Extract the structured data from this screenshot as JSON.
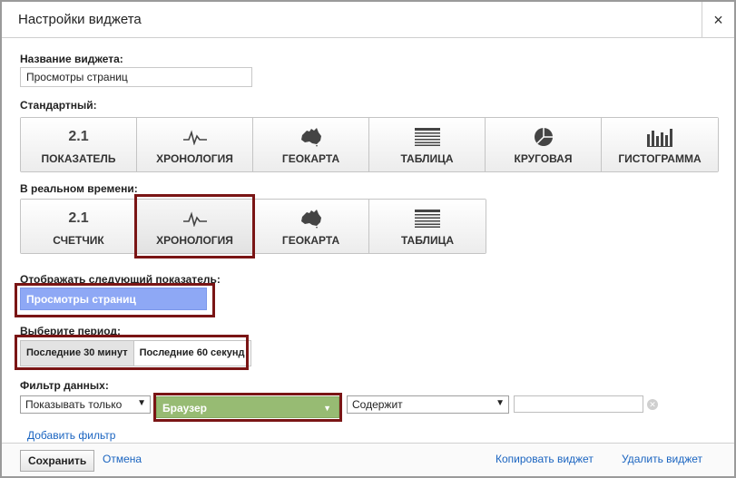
{
  "dialog": {
    "title": "Настройки виджета",
    "close_label": "×"
  },
  "widget_name": {
    "label": "Название виджета:",
    "value": "Просмотры страниц"
  },
  "standard": {
    "label": "Стандартный:",
    "buttons": [
      {
        "icon_text": "2.1",
        "icon": "number-icon",
        "label": "ПОКАЗАТЕЛЬ"
      },
      {
        "icon": "timeline-icon",
        "label": "ХРОНОЛОГИЯ"
      },
      {
        "icon": "map-icon",
        "label": "ГЕОКАРТА"
      },
      {
        "icon": "table-icon",
        "label": "ТАБЛИЦА"
      },
      {
        "icon": "pie-icon",
        "label": "КРУГОВАЯ"
      },
      {
        "icon": "bar-chart-icon",
        "label": "ГИСТОГРАММА"
      }
    ]
  },
  "realtime": {
    "label": "В реальном времени:",
    "selected": "ХРОНОЛОГИЯ",
    "buttons": [
      {
        "icon_text": "2.1",
        "icon": "number-icon",
        "label": "СЧЕТЧИК"
      },
      {
        "icon": "timeline-icon",
        "label": "ХРОНОЛОГИЯ"
      },
      {
        "icon": "map-icon",
        "label": "ГЕОКАРТА"
      },
      {
        "icon": "table-icon",
        "label": "ТАБЛИЦА"
      }
    ]
  },
  "metric": {
    "label": "Отображать следующий показатель:",
    "value": "Просмотры страниц"
  },
  "period": {
    "label": "Выберите период:",
    "selected": "Последние 30 минут",
    "options": [
      "Последние 30 минут",
      "Последние 60 секунд"
    ]
  },
  "filter": {
    "label": "Фильтр данных:",
    "mode": "Показывать только",
    "dimension": "Браузер",
    "condition": "Содержит",
    "value": "",
    "add_link": "Добавить фильтр"
  },
  "footer": {
    "save": "Сохранить",
    "cancel": "Отмена",
    "copy": "Копировать виджет",
    "delete": "Удалить виджет"
  },
  "colors": {
    "highlight": "#7a1515",
    "metric_bg": "#8ea8f5",
    "filter_bg": "#97bb73",
    "link": "#1a64c0"
  }
}
